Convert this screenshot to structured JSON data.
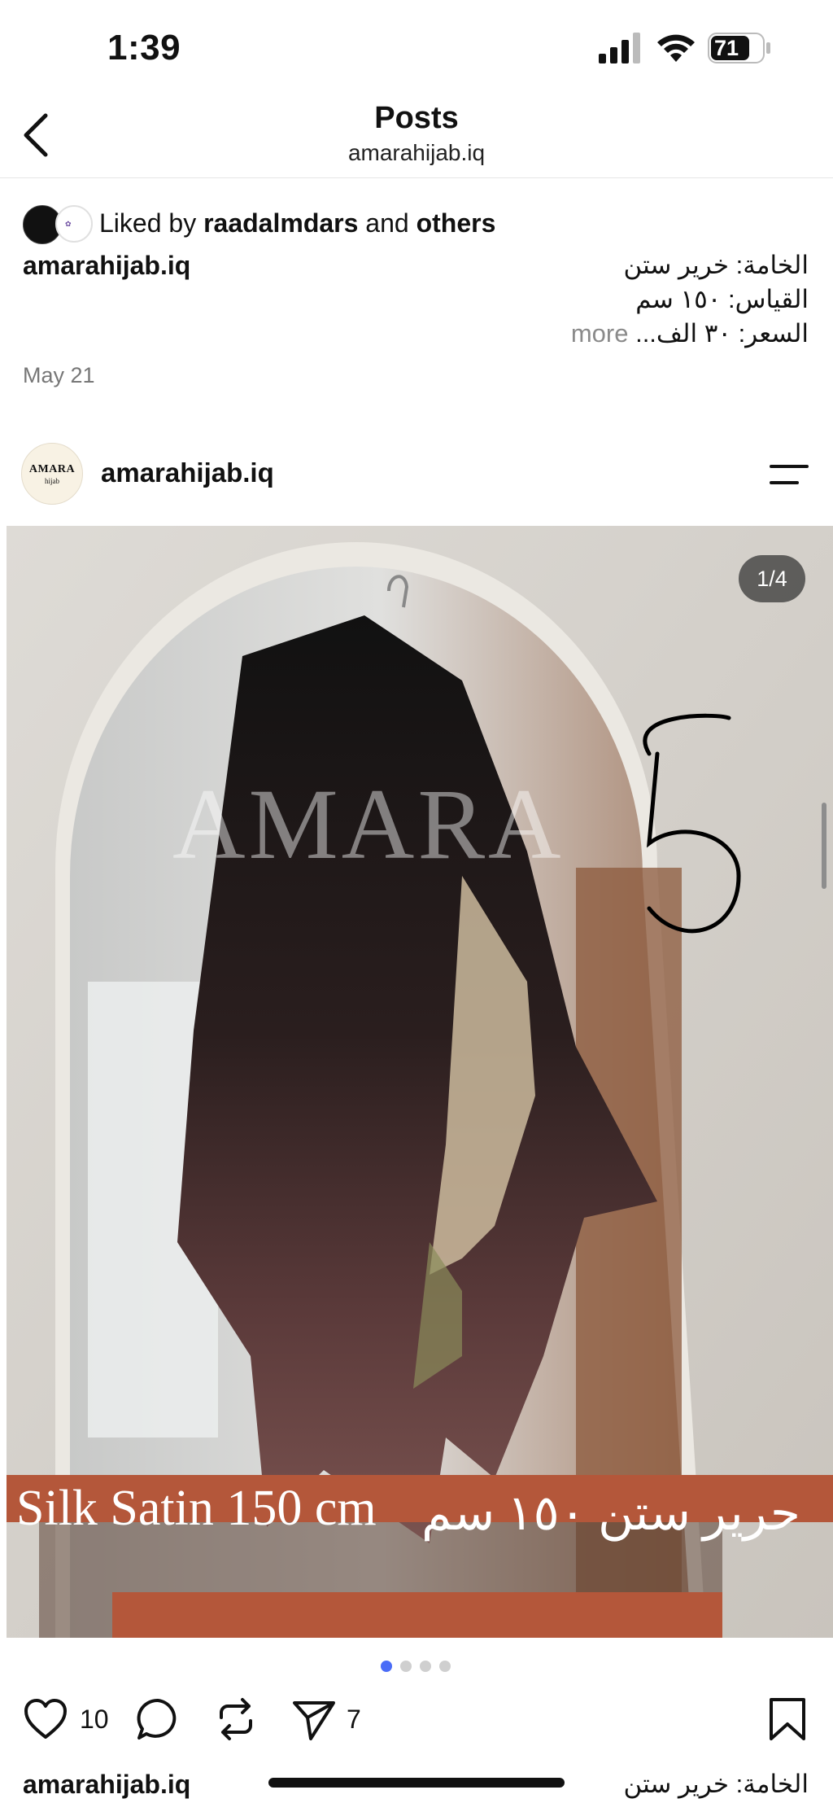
{
  "status_bar": {
    "time": "1:39",
    "battery": "71"
  },
  "header": {
    "title": "Posts",
    "subtitle": "amarahijab.iq",
    "back_icon": "chevron-left-icon"
  },
  "previous_post": {
    "liked_prefix": "Liked by",
    "liked_user": "raadalmdars",
    "liked_and": "and",
    "liked_others": "others",
    "username": "amarahijab.iq",
    "caption_line1": "الخامة: خرير ستن",
    "caption_line2": "القياس: ١٥٠ سم",
    "caption_line3": "السعر: ٣٠ الف...",
    "more_label": "more",
    "date": "May 21"
  },
  "post": {
    "username": "amarahijab.iq",
    "avatar_line1": "AMARA",
    "avatar_line2": "hijab",
    "menu_icon": "menu-lines-icon",
    "image_counter": "1/4",
    "watermark": "AMARA",
    "number_mark": "5",
    "banner_en": "Silk Satin 150 cm",
    "banner_ar": "حرير ستن ١٥٠ سم",
    "carousel_total": 4,
    "carousel_active": 1,
    "likes": "10",
    "shares": "7",
    "icons": {
      "like": "heart-icon",
      "comment": "comment-icon",
      "repost": "repost-icon",
      "share": "send-icon",
      "save": "bookmark-icon"
    },
    "colors": {
      "active_dot": "#4a6cf7",
      "banner": "#b4573a"
    }
  },
  "next_caption": {
    "username": "amarahijab.iq",
    "caption_line1": "الخامة: خرير ستن"
  }
}
